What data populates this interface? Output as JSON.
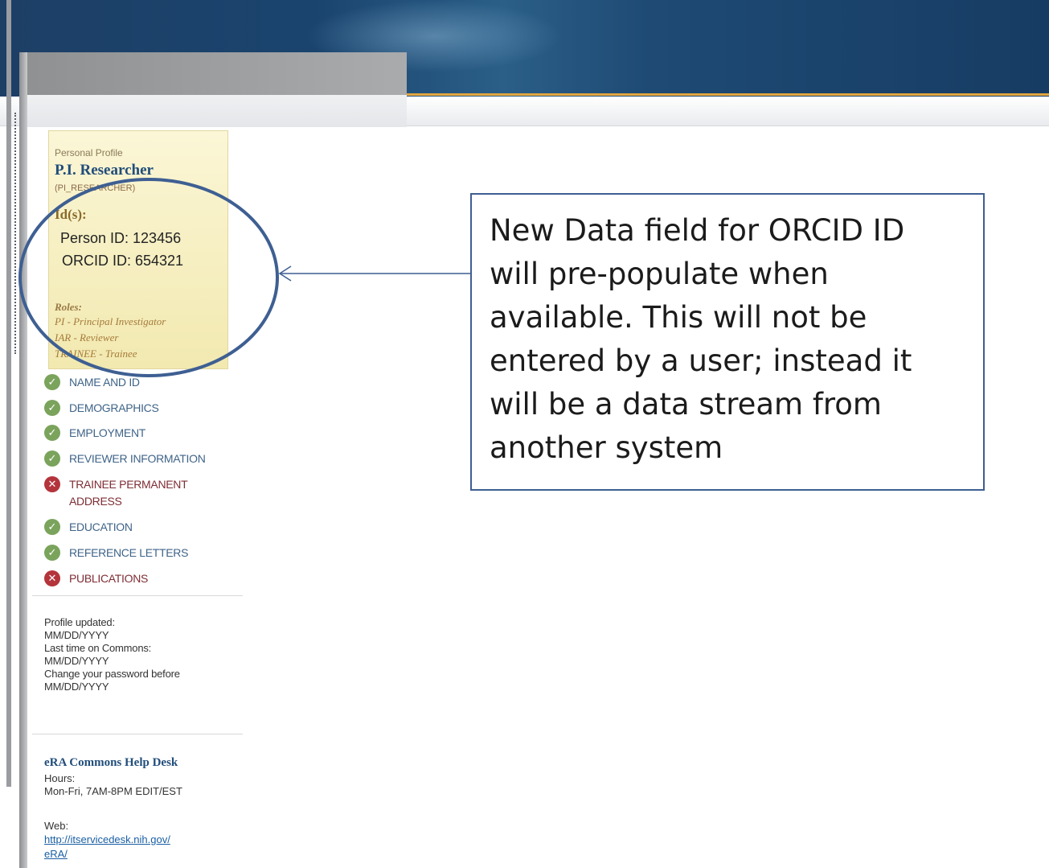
{
  "profile": {
    "section_label": "Personal Profile",
    "name": "P.I. Researcher",
    "username": "(PI_RESEARCHER)",
    "ids_label": "Id(s):",
    "person_id": "Person ID: 123456",
    "orcid_id": "ORCID ID: 654321",
    "roles_label": "Roles:",
    "roles": [
      "PI - Principal Investigator",
      "IAR - Reviewer",
      "TRAINEE - Trainee"
    ]
  },
  "nav": {
    "items": [
      {
        "label": "NAME AND ID",
        "status": "complete"
      },
      {
        "label": "DEMOGRAPHICS",
        "status": "complete"
      },
      {
        "label": "EMPLOYMENT",
        "status": "complete"
      },
      {
        "label": "REVIEWER INFORMATION",
        "status": "complete"
      },
      {
        "label": "TRAINEE PERMANENT ADDRESS",
        "status": "incomplete"
      },
      {
        "label": "EDUCATION",
        "status": "complete"
      },
      {
        "label": "REFERENCE LETTERS",
        "status": "complete"
      },
      {
        "label": "PUBLICATIONS",
        "status": "incomplete"
      }
    ]
  },
  "status": {
    "profile_updated_label": "Profile updated:",
    "profile_updated_value": "MM/DD/YYYY",
    "last_time_label": "Last time on Commons:",
    "last_time_value": "MM/DD/YYYY",
    "password_label": "Change your password before",
    "password_value": "MM/DD/YYYY"
  },
  "help": {
    "title": "eRA Commons Help Desk",
    "hours_label": "Hours:",
    "hours_value": "Mon-Fri, 7AM-8PM EDIT/EST",
    "web_label": "Web:",
    "web_url_line1": "http://itservicedesk.nih.gov/",
    "web_url_line2": "eRA/"
  },
  "callout": {
    "text": "New Data field for ORCID ID\nwill pre-populate when\navailable.  This will not be\nentered by a user; instead it\nwill be a data stream from\nanother system"
  },
  "colors": {
    "banner": "#1d3f66",
    "accent_rule": "#e3a640",
    "profile_bg": "#fbf6d6",
    "annotation": "#3e5f92",
    "complete": "#7aa35c",
    "incomplete": "#b4343c",
    "link": "#1a5fa3"
  },
  "icons": {
    "complete": "check-circle-icon",
    "incomplete": "x-circle-icon"
  }
}
